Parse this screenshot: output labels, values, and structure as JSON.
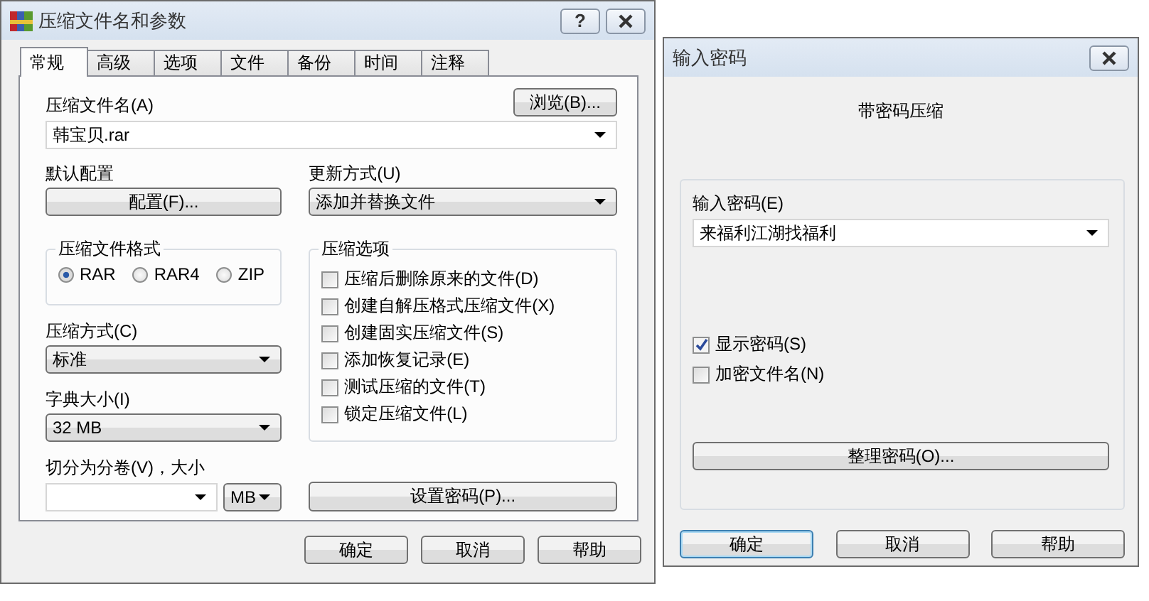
{
  "main_window": {
    "title": "压缩文件名和参数",
    "help_button": "?",
    "tabs": [
      {
        "label": "常规",
        "selected": true
      },
      {
        "label": "高级",
        "selected": false
      },
      {
        "label": "选项",
        "selected": false
      },
      {
        "label": "文件",
        "selected": false
      },
      {
        "label": "备份",
        "selected": false
      },
      {
        "label": "时间",
        "selected": false
      },
      {
        "label": "注释",
        "selected": false
      }
    ],
    "archive_name": {
      "label": "压缩文件名(A)",
      "browse_button": "浏览(B)...",
      "value": "韩宝贝.rar"
    },
    "default_profile": {
      "label": "默认配置",
      "button": "配置(F)..."
    },
    "update_mode": {
      "label": "更新方式(U)",
      "value": "添加并替换文件"
    },
    "archive_format": {
      "title": "压缩文件格式",
      "options": [
        {
          "label": "RAR",
          "selected": true
        },
        {
          "label": "RAR4",
          "selected": false
        },
        {
          "label": "ZIP",
          "selected": false
        }
      ]
    },
    "compression_options": {
      "title": "压缩选项",
      "options": [
        {
          "label": "压缩后删除原来的文件(D)",
          "checked": false
        },
        {
          "label": "创建自解压格式压缩文件(X)",
          "checked": false
        },
        {
          "label": "创建固实压缩文件(S)",
          "checked": false
        },
        {
          "label": "添加恢复记录(E)",
          "checked": false
        },
        {
          "label": "测试压缩的文件(T)",
          "checked": false
        },
        {
          "label": "锁定压缩文件(L)",
          "checked": false
        }
      ]
    },
    "compression_method": {
      "label": "压缩方式(C)",
      "value": "标准"
    },
    "dictionary_size": {
      "label": "字典大小(I)",
      "value": "32 MB"
    },
    "split_volumes": {
      "label": "切分为分卷(V)，大小",
      "unit": "MB"
    },
    "set_password_button": "设置密码(P)...",
    "buttons": [
      {
        "label": "确定",
        "default": false
      },
      {
        "label": "取消",
        "default": false
      },
      {
        "label": "帮助",
        "default": false
      }
    ]
  },
  "password_window": {
    "title": "输入密码",
    "heading": "带密码压缩",
    "password": {
      "label": "输入密码(E)",
      "value": "来福利江湖找福利"
    },
    "options": [
      {
        "label": "显示密码(S)",
        "checked": true
      },
      {
        "label": "加密文件名(N)",
        "checked": false
      }
    ],
    "organize_button": "整理密码(O)...",
    "buttons": [
      {
        "label": "确定",
        "default": true
      },
      {
        "label": "取消",
        "default": false
      },
      {
        "label": "帮助",
        "default": false
      }
    ]
  }
}
